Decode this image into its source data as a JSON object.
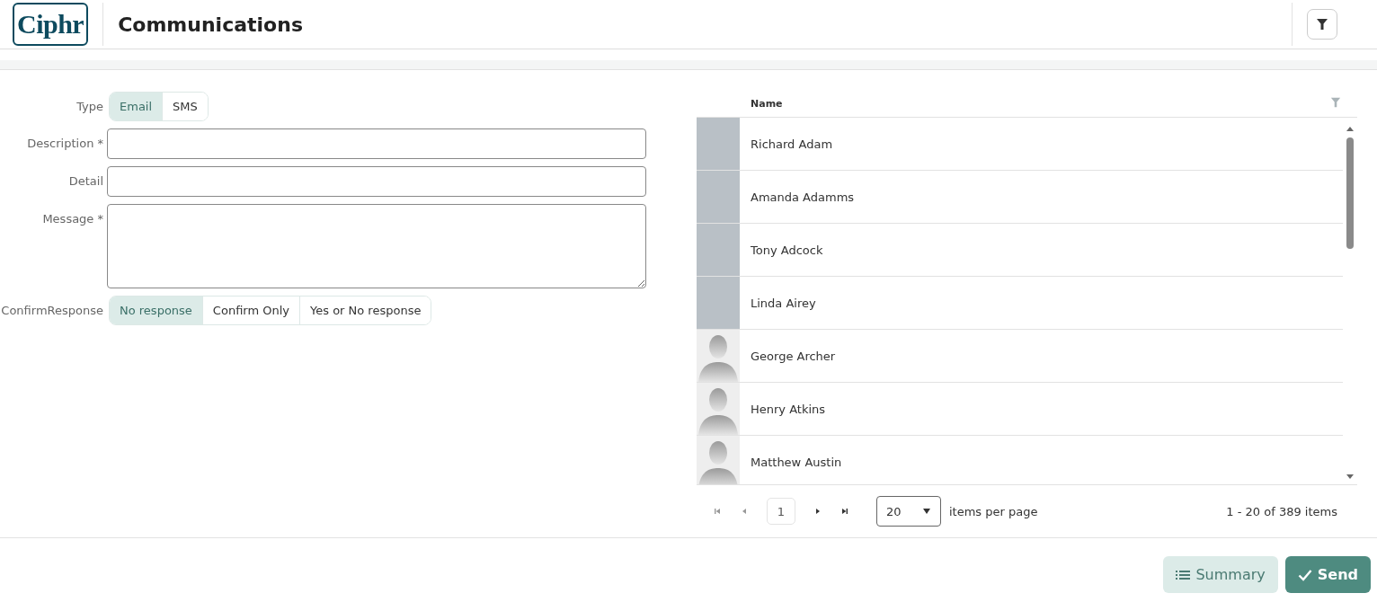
{
  "header": {
    "logo": "Ciphr",
    "title": "Communications"
  },
  "form": {
    "type": {
      "label": "Type",
      "options": [
        {
          "label": "Email",
          "selected": true
        },
        {
          "label": "SMS",
          "selected": false
        }
      ]
    },
    "fields": [
      {
        "label": "Description *",
        "kind": "line"
      },
      {
        "label": "Detail",
        "kind": "line"
      },
      {
        "label": "Message *",
        "kind": "area"
      }
    ],
    "confirm": {
      "label": "ConfirmResponse",
      "options": [
        {
          "label": "No response",
          "selected": true
        },
        {
          "label": "Confirm Only",
          "selected": false
        },
        {
          "label": "Yes or No response",
          "selected": false
        }
      ]
    }
  },
  "grid": {
    "column": "Name",
    "rows": [
      {
        "name": "Richard Adam",
        "kind": "photo"
      },
      {
        "name": "Amanda Adamms",
        "kind": "photo"
      },
      {
        "name": "Tony Adcock",
        "kind": "photo"
      },
      {
        "name": "Linda Airey",
        "kind": "photo"
      },
      {
        "name": "George Archer",
        "kind": "silhouette"
      },
      {
        "name": "Henry Atkins",
        "kind": "silhouette"
      },
      {
        "name": "Matthew Austin",
        "kind": "silhouette"
      }
    ],
    "pager": {
      "page": "1",
      "page_size": "20",
      "page_size_label": "items per page",
      "summary": "1 - 20 of 389 items"
    }
  },
  "buttons": [
    {
      "label": "Summary",
      "kind": "secondary"
    },
    {
      "label": "Send",
      "kind": "primary"
    }
  ]
}
